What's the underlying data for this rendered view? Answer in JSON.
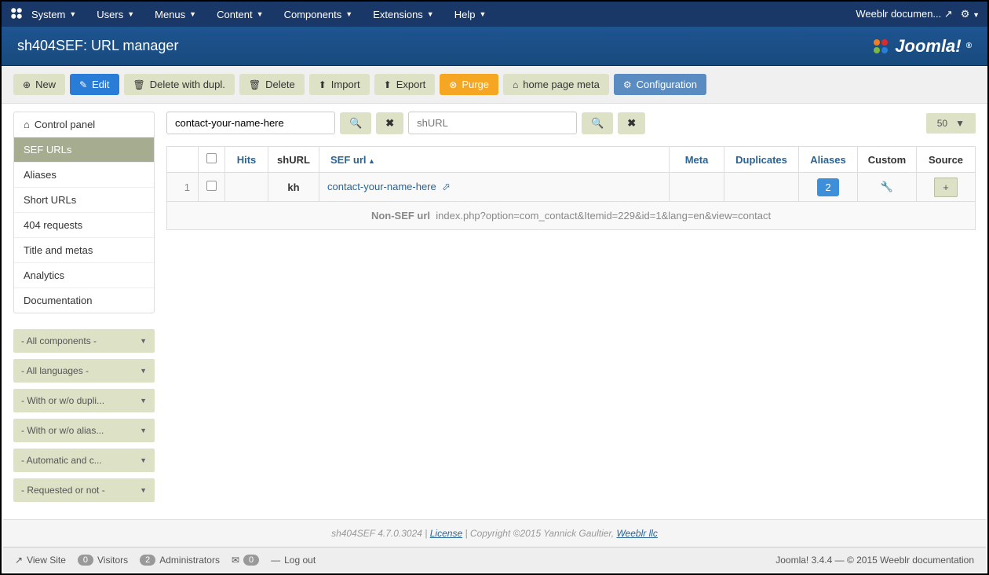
{
  "topnav": {
    "items": [
      {
        "label": "System"
      },
      {
        "label": "Users"
      },
      {
        "label": "Menus"
      },
      {
        "label": "Content"
      },
      {
        "label": "Components"
      },
      {
        "label": "Extensions"
      },
      {
        "label": "Help"
      }
    ],
    "right_label": "Weeblr documen..."
  },
  "page_title": "sh404SEF: URL manager",
  "joomla_brand": "Joomla!",
  "toolbar": {
    "new_label": "New",
    "edit_label": "Edit",
    "delete_dupl_label": "Delete with dupl.",
    "delete_label": "Delete",
    "import_label": "Import",
    "export_label": "Export",
    "purge_label": "Purge",
    "homepage_meta_label": "home page meta",
    "config_label": "Configuration"
  },
  "sidebar": {
    "items": [
      {
        "label": "Control panel",
        "active": false,
        "icon": "home"
      },
      {
        "label": "SEF URLs",
        "active": true
      },
      {
        "label": "Aliases",
        "active": false
      },
      {
        "label": "Short URLs",
        "active": false
      },
      {
        "label": "404 requests",
        "active": false
      },
      {
        "label": "Title and metas",
        "active": false
      },
      {
        "label": "Analytics",
        "active": false
      },
      {
        "label": "Documentation",
        "active": false
      }
    ],
    "filters": [
      {
        "label": "- All components -"
      },
      {
        "label": "- All languages -"
      },
      {
        "label": "- With or w/o dupli..."
      },
      {
        "label": "- With or w/o alias..."
      },
      {
        "label": "- Automatic and c..."
      },
      {
        "label": "- Requested or not -"
      }
    ]
  },
  "search": {
    "value1": "contact-your-name-here",
    "placeholder1": "",
    "value2": "",
    "placeholder2": "shURL",
    "limit": "50"
  },
  "table": {
    "headers": {
      "hits": "Hits",
      "shurl": "shURL",
      "sefurl": "SEF url",
      "meta": "Meta",
      "duplicates": "Duplicates",
      "aliases": "Aliases",
      "custom": "Custom",
      "source": "Source"
    },
    "row": {
      "num": "1",
      "hits": "",
      "shurl": "kh",
      "sefurl": "contact-your-name-here",
      "meta": "",
      "duplicates": "",
      "aliases": "2",
      "source_plus": "+"
    },
    "nonsef_label": "Non-SEF url",
    "nonsef_value": "index.php?option=com_contact&Itemid=229&id=1&lang=en&view=contact"
  },
  "versionbar": {
    "product": "sh404SEF 4.7.0.3024",
    "license": "License",
    "copyright": "Copyright ©2015 Yannick Gaultier,",
    "company": "Weeblr llc"
  },
  "statusbar": {
    "view_site": "View Site",
    "visitors_count": "0",
    "visitors_label": "Visitors",
    "admins_count": "2",
    "admins_label": "Administrators",
    "messages_count": "0",
    "logout": "Log out",
    "right": "Joomla! 3.4.4  —  © 2015 Weeblr documentation"
  }
}
